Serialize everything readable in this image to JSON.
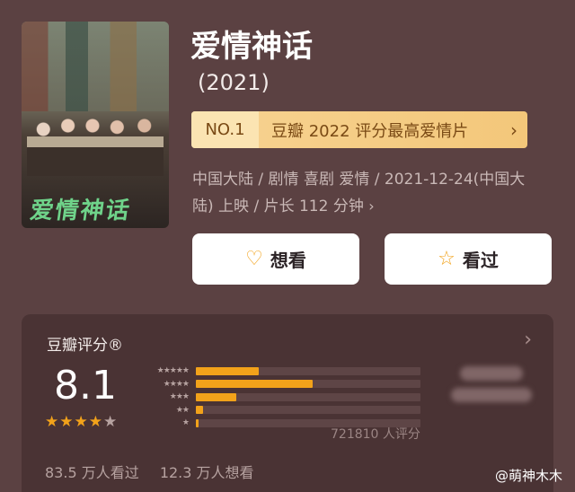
{
  "movie": {
    "title": "爱情神话",
    "year": "(2021)",
    "poster_title": "爱情神话"
  },
  "rank": {
    "number": "NO.1",
    "text": "豆瓣 2022 评分最高爱情片"
  },
  "meta": {
    "line1": "中国大陆 / 剧情 喜剧 爱情 / 2021-12-24(中国大",
    "line2": "陆) 上映 / 片长 112 分钟"
  },
  "actions": {
    "want": "想看",
    "seen": "看过"
  },
  "rating": {
    "label": "豆瓣评分®",
    "score": "8.1",
    "stars_filled": 4,
    "stars_total": 5,
    "distribution": [
      {
        "stars": "★★★★★",
        "percent": 28
      },
      {
        "stars": "★★★★",
        "percent": 52
      },
      {
        "stars": "★★★",
        "percent": 18
      },
      {
        "stars": "★★",
        "percent": 3
      },
      {
        "stars": "★",
        "percent": 1
      }
    ],
    "count_text": "721810 人评分",
    "watched": "83.5 万人看过",
    "want_count": "12.3 万人想看"
  },
  "watermark": "@萌神木木",
  "colors": {
    "background": "#5b4142",
    "accent": "#f2a21a",
    "badge": "#f7d392"
  }
}
